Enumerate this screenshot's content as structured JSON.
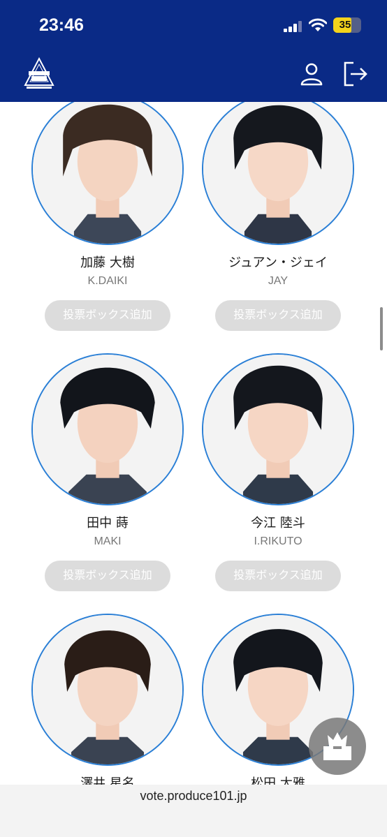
{
  "status_bar": {
    "time": "23:46",
    "battery": "35"
  },
  "header": {
    "logo_icon": "produce-101-logo",
    "user_icon": "user-icon",
    "logout_icon": "logout-icon"
  },
  "trainees": [
    {
      "name": "加藤 大樹",
      "romaji": "K.DAIKI",
      "button": "投票ボックス追加"
    },
    {
      "name": "ジュアン・ジェイ",
      "romaji": "JAY",
      "button": "投票ボックス追加"
    },
    {
      "name": "田中 蒔",
      "romaji": "MAKI",
      "button": "投票ボックス追加"
    },
    {
      "name": "今江 陸斗",
      "romaji": "I.RIKUTO",
      "button": "投票ボックス追加"
    },
    {
      "name": "澤井 星名",
      "romaji": "",
      "button": ""
    },
    {
      "name": "松田 太雅",
      "romaji": "",
      "button": ""
    }
  ],
  "fab": {
    "icon": "vote-box-crown-icon"
  },
  "browser": {
    "url": "vote.produce101.jp"
  },
  "colors": {
    "header_bg": "#0a2a86",
    "photo_border": "#2a7fd6",
    "button_bg": "#dcdcdc"
  }
}
